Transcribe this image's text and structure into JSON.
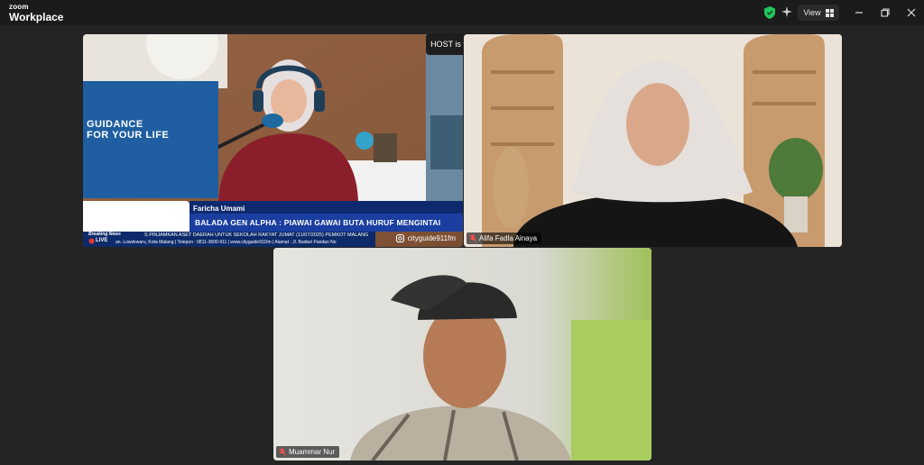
{
  "app": {
    "brand_top": "zoom",
    "brand_bottom": "Workplace"
  },
  "toolbar": {
    "view_label": "View"
  },
  "toast": {
    "text": "HOST is talking..."
  },
  "tiles": [
    {
      "participant": "",
      "overlay": {
        "panel_text": "GUIDANCE",
        "panel_text2": "FOR YOUR LIFE",
        "host_name": "Faricha Umami",
        "headline": "BALADA GEN ALPHA : PIAWAI GAWAI BUTA HURUF MENGINTAI",
        "social_handle": "cityguide911fm",
        "breaking_label": "Breaking News",
        "live_label": "LIVE",
        "ticker_line1": "S PINJAMKAN ASET DAERAH UNTUK SEKOLAH RAKYAT    JUMAT (11/07/2025) PEMKOT MALANG",
        "ticker_line2": "an. Lowokwaru, Kota Malang | Telepon : 0811-3600-911 | www.cityguide911fm | Alamat : Jl. Baiduri Pandan No"
      }
    },
    {
      "participant": "Alifa Fadla Ainaya"
    },
    {
      "participant": "Muammar Nur"
    }
  ]
}
